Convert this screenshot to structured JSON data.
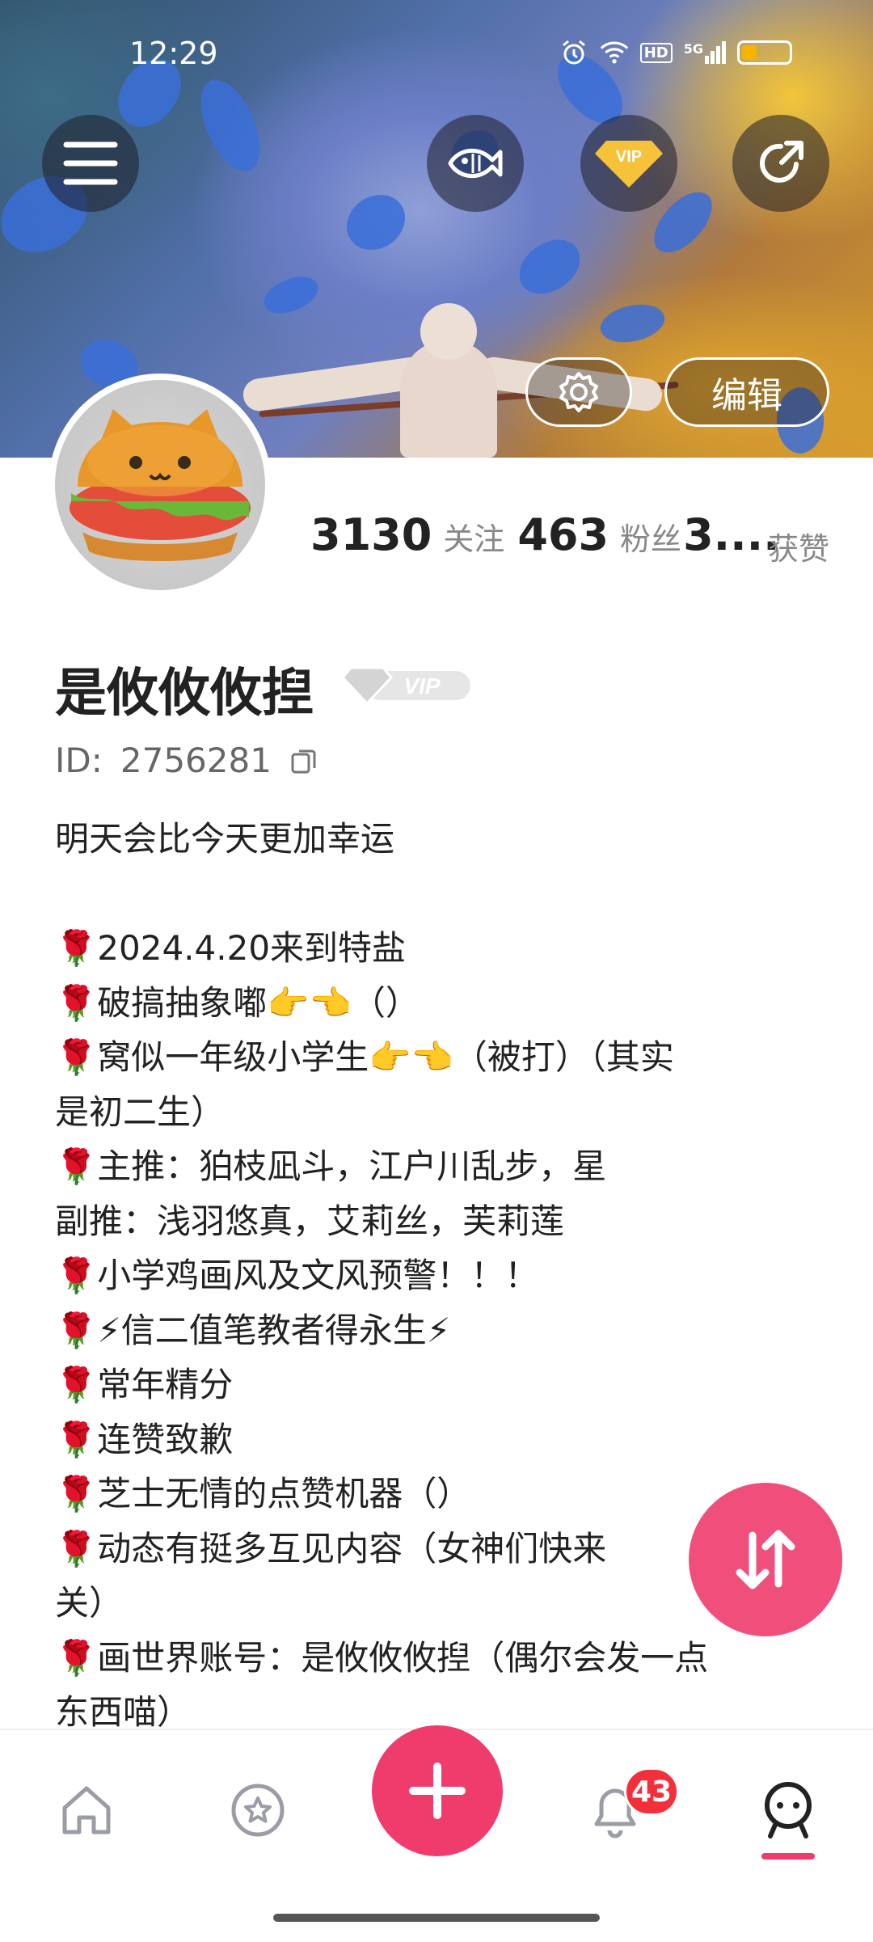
{
  "status_bar": {
    "time": "12:29",
    "network": "5G",
    "hd": "HD"
  },
  "banner": {
    "menu_icon": "hamburger-icon",
    "fish_icon": "fish-icon",
    "vip_icon": "vip-diamond-icon",
    "vip_text": "VIP",
    "share_icon": "share-icon",
    "settings_icon": "gear-icon",
    "edit_label": "编辑"
  },
  "stats": {
    "following_count": "3130",
    "following_label": "关注",
    "followers_count": "463",
    "followers_label": "粉丝",
    "likes_count": "3....",
    "likes_label": "获赞"
  },
  "profile": {
    "name": "是攸攸攸揑",
    "vip_badge": "VIP",
    "id_label": "ID:",
    "id_value": "2756281",
    "bio_lines": [
      "明天会比今天更加幸运",
      "",
      "🌹2024.4.20来到特盐",
      "🌹破搞抽象嘟👉👈（）",
      "🌹窝似一年级小学生👉👈（被打）（其实",
      "是初二生）",
      "🌹主推：狛枝凪斗，江户川乱步，星",
      "副推：浅羽悠真，艾莉丝，芙莉莲",
      "🌹小学鸡画风及文风预警！！！",
      "🌹⚡信二值笔教者得永生⚡",
      "🌹常年精分",
      "🌹连赞致歉",
      "🌹芝士无情的点赞机器（）",
      "🌹动态有挺多互见内容（女神们快来",
      "关）",
      "🌹画世界账号：是攸攸攸揑（偶尔会发一点",
      "东西喵）"
    ]
  },
  "nav": {
    "notification_badge": "43",
    "items": [
      "home-icon",
      "star-icon",
      "add-icon",
      "bell-icon",
      "profile-icon"
    ]
  },
  "colors": {
    "accent": "#f03c6c",
    "badge": "#f2303b",
    "fab": "#f04f7b"
  }
}
